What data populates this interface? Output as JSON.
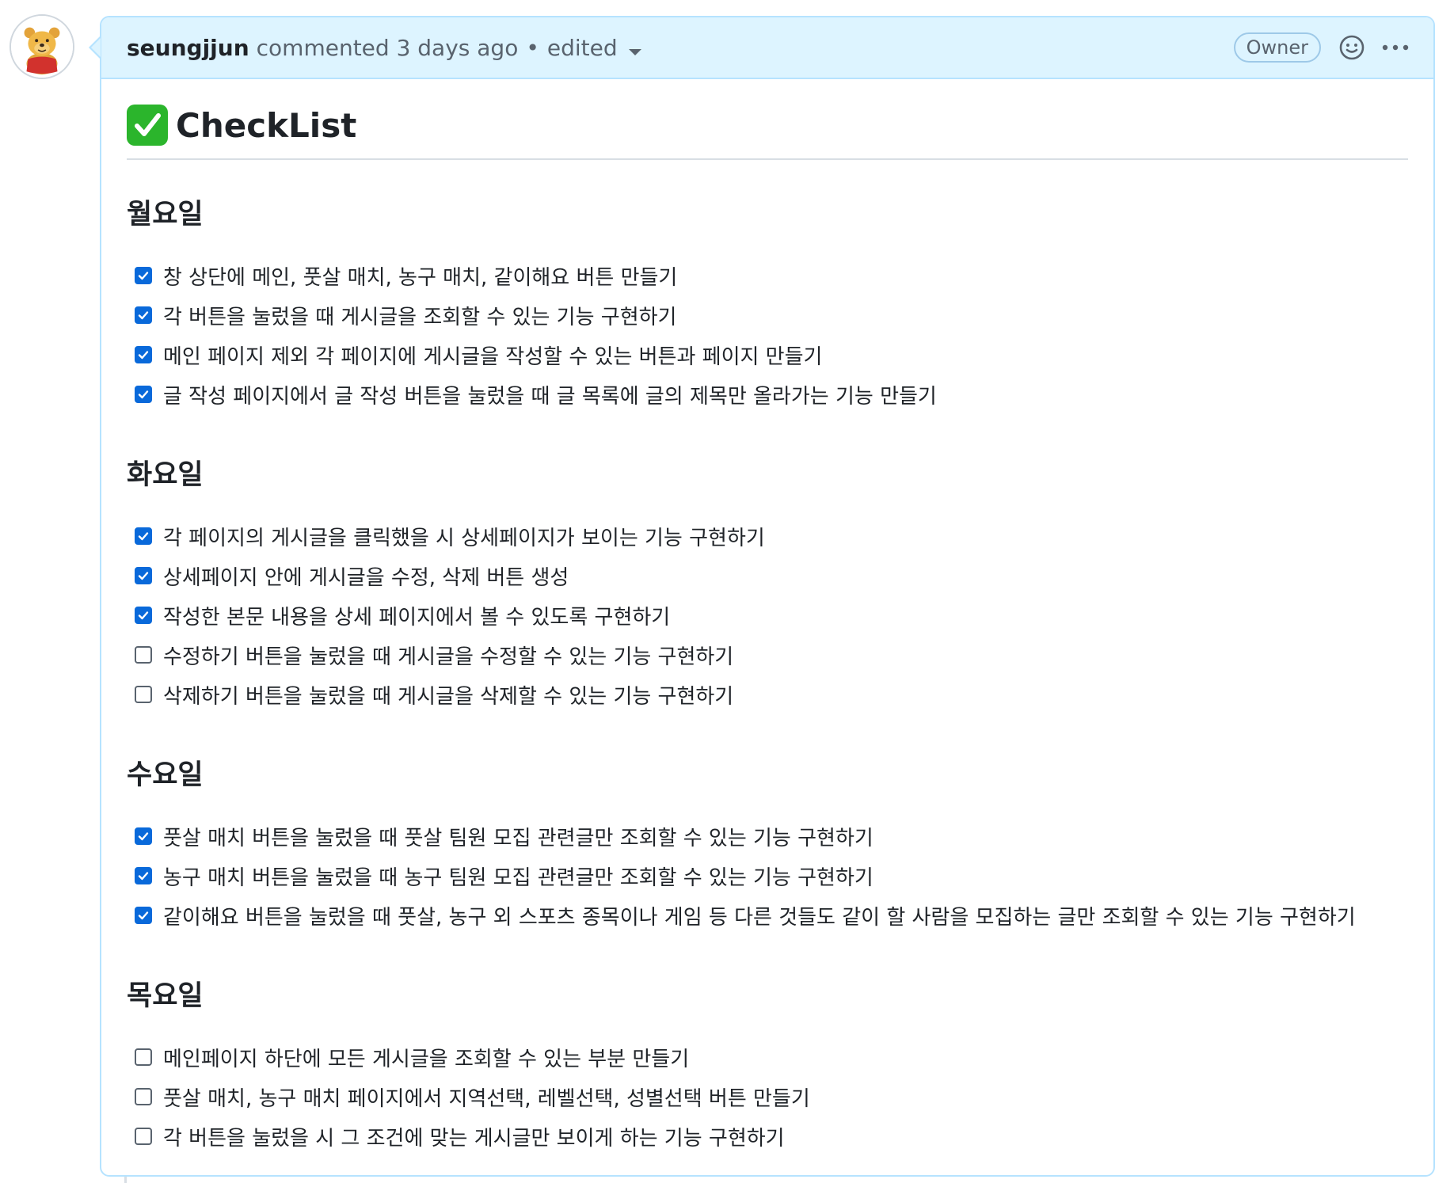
{
  "comment": {
    "author": "seungjjun",
    "action": "commented 3 days ago",
    "separator": "•",
    "edited": "edited",
    "badge": "Owner",
    "avatar_icon": "winnie-the-pooh-avatar",
    "reaction_icon": "smiley-icon",
    "menu_icon": "kebab-horizontal-icon"
  },
  "body": {
    "title_emoji": "white-check-mark-emoji",
    "title": "CheckList",
    "sections": [
      {
        "day": "월요일",
        "items": [
          {
            "text": "창 상단에 메인, 풋살 매치, 농구 매치, 같이해요 버튼 만들기",
            "checked": true
          },
          {
            "text": "각 버튼을 눌렀을 때 게시글을 조회할 수 있는 기능 구현하기",
            "checked": true
          },
          {
            "text": "메인 페이지 제외 각 페이지에 게시글을 작성할 수 있는 버튼과 페이지 만들기",
            "checked": true
          },
          {
            "text": "글 작성 페이지에서 글 작성 버튼을 눌렀을 때 글 목록에 글의 제목만 올라가는 기능 만들기",
            "checked": true
          }
        ]
      },
      {
        "day": "화요일",
        "items": [
          {
            "text": "각 페이지의 게시글을 클릭했을 시 상세페이지가 보이는 기능 구현하기",
            "checked": true
          },
          {
            "text": "상세페이지 안에 게시글을 수정, 삭제 버튼 생성",
            "checked": true
          },
          {
            "text": "작성한 본문 내용을 상세 페이지에서 볼 수 있도록 구현하기",
            "checked": true
          },
          {
            "text": "수정하기 버튼을 눌렀을 때 게시글을 수정할 수 있는 기능 구현하기",
            "checked": false
          },
          {
            "text": "삭제하기 버튼을 눌렀을 때 게시글을 삭제할 수 있는 기능 구현하기",
            "checked": false
          }
        ]
      },
      {
        "day": "수요일",
        "items": [
          {
            "text": "풋살 매치 버튼을 눌렀을 때 풋살 팀원 모집 관련글만 조회할 수 있는 기능 구현하기",
            "checked": true
          },
          {
            "text": "농구 매치 버튼을 눌렀을 때 농구 팀원 모집 관련글만 조회할 수 있는 기능 구현하기",
            "checked": true
          },
          {
            "text": "같이해요 버튼을 눌렀을 때 풋살, 농구 외 스포츠 종목이나 게임 등 다른 것들도 같이 할 사람을 모집하는 글만 조회할 수 있는 기능 구현하기",
            "checked": true
          }
        ]
      },
      {
        "day": "목요일",
        "items": [
          {
            "text": "메인페이지 하단에 모든 게시글을 조회할 수 있는 부분 만들기",
            "checked": false
          },
          {
            "text": "풋살 매치, 농구 매치 페이지에서 지역선택, 레벨선택, 성별선택 버튼 만들기",
            "checked": false
          },
          {
            "text": "각 버튼을 눌렀을 시 그 조건에 맞는 게시글만 보이게 하는 기능 구현하기",
            "checked": false
          }
        ]
      }
    ]
  }
}
